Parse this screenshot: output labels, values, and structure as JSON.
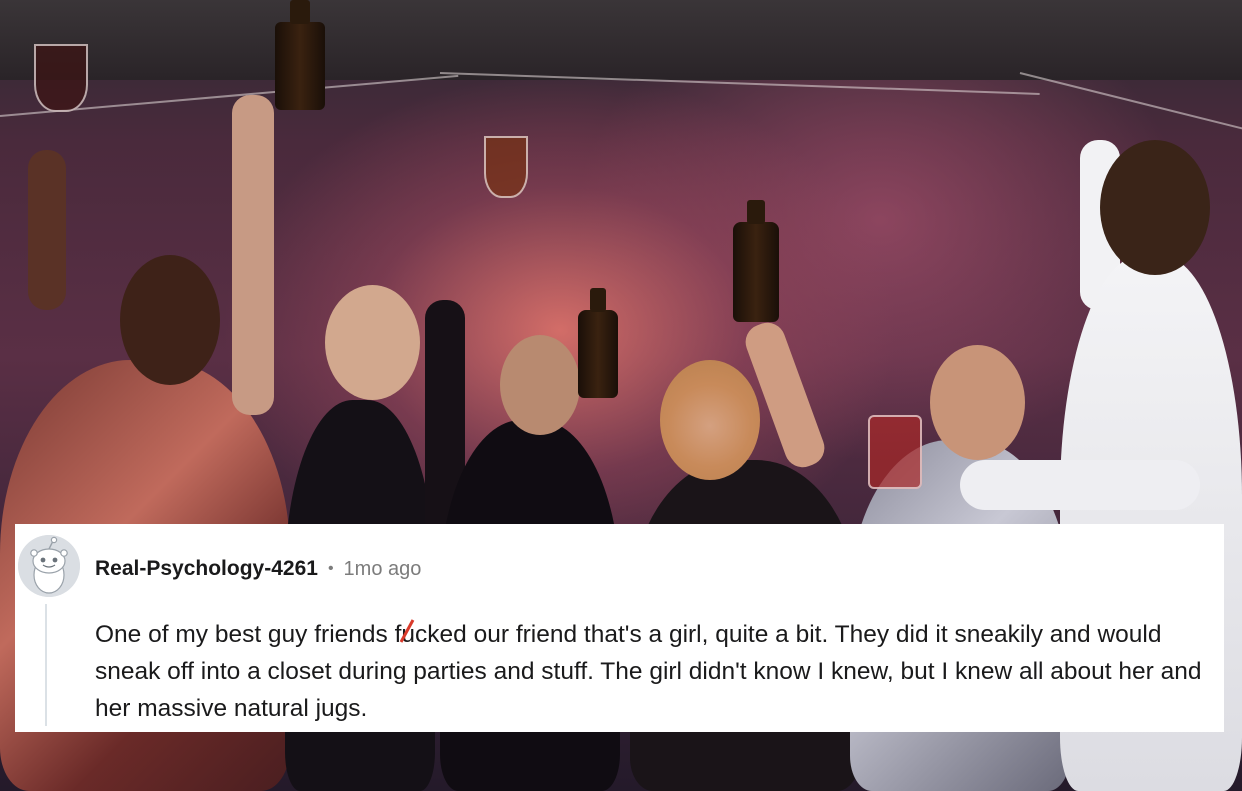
{
  "comment": {
    "username": "Real-Psychology-4261",
    "separator": "•",
    "timestamp": "1mo ago",
    "body_before": "One of my best guy friends f",
    "body_censored_char": "u",
    "body_after": "cked our friend that's a girl, quite a bit. They did it sneakily and would sneak off into a closet during parties and stuff. The girl didn't know I knew, but I knew all about her and her massive natural jugs.",
    "avatar_icon": "snoo-avatar-icon",
    "censor_mark_color": "#d93a2b"
  },
  "colors": {
    "card_bg": "#ffffff",
    "text_primary": "#1a1a1b",
    "text_muted": "#7c7c7c",
    "thread_line": "#dbe1e6"
  }
}
